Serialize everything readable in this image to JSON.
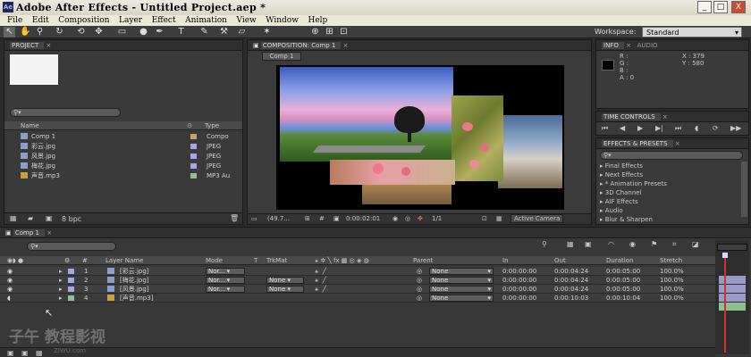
{
  "window": {
    "title": "Adobe After Effects - Untitled Project.aep *",
    "app_icon": "Ae",
    "controls": [
      "_",
      "□",
      "X"
    ]
  },
  "menu": [
    "File",
    "Edit",
    "Composition",
    "Layer",
    "Effect",
    "Animation",
    "View",
    "Window",
    "Help"
  ],
  "toolbar": {
    "workspace_label": "Workspace:",
    "workspace_value": "Standard"
  },
  "project": {
    "tab": "PROJECT",
    "search_placeholder": "",
    "columns": {
      "name": "Name",
      "type": "Type"
    },
    "items": [
      {
        "name": "Comp 1",
        "color": "#c9a26a",
        "type": "Compo",
        "icon": "composition-icon"
      },
      {
        "name": "彩云.jpg",
        "color": "#a6a6e6",
        "type": "JPEG",
        "icon": "image-icon"
      },
      {
        "name": "风景.jpg",
        "color": "#a6a6e6",
        "type": "JPEG",
        "icon": "image-icon"
      },
      {
        "name": "梅花.jpg",
        "color": "#a6a6e6",
        "type": "JPEG",
        "icon": "image-icon"
      },
      {
        "name": "声音.mp3",
        "color": "#8fc08f",
        "type": "MP3 Au",
        "icon": "audio-icon"
      }
    ],
    "bpc": "8 bpc"
  },
  "composition": {
    "tab": "COMPOSITION: Comp 1",
    "subtab": "Comp 1",
    "zoom": "(49.7...",
    "timecode": "0:00:02:01",
    "resolution": "1/1",
    "camera": "Active Camera"
  },
  "info": {
    "tab": "INFO",
    "tab2": "AUDIO",
    "r": "R :",
    "g": "G :",
    "b": "B :",
    "a": "A : 0",
    "x": "X : 379",
    "y": "Y : 580"
  },
  "time_controls": {
    "tab": "TIME CONTROLS"
  },
  "effects": {
    "tab": "EFFECTS & PRESETS",
    "search_placeholder": "",
    "items": [
      "Final Effects",
      "Next Effects",
      "* Animation Presets",
      "3D Channel",
      "AIF Effects",
      "Audio",
      "Blur & Sharpen"
    ]
  },
  "timeline": {
    "tab": "Comp 1",
    "columns": {
      "num": "#",
      "layer_name": "Layer Name",
      "mode": "Mode",
      "t": "T",
      "trkmat": "TrkMat",
      "parent": "Parent",
      "in": "In",
      "out": "Out",
      "duration": "Duration",
      "stretch": "Stretch"
    },
    "layers": [
      {
        "num": "1",
        "name": "[彩云.jpg]",
        "color": "#a6a6e6",
        "mode": "Nor...",
        "trkmat": "",
        "parent": "None",
        "in": "0:00:00:00",
        "out": "0:00:04:24",
        "duration": "0:00:05:00",
        "stretch": "100.0%"
      },
      {
        "num": "2",
        "name": "[梅花.jpg]",
        "color": "#a6a6e6",
        "mode": "Nor...",
        "trkmat": "None",
        "parent": "None",
        "in": "0:00:00:00",
        "out": "0:00:04:24",
        "duration": "0:00:05:00",
        "stretch": "100.0%"
      },
      {
        "num": "3",
        "name": "[风景.jpg]",
        "color": "#a6a6e6",
        "mode": "Nor...",
        "trkmat": "None",
        "parent": "None",
        "in": "0:00:00:00",
        "out": "0:00:04:24",
        "duration": "0:00:05:00",
        "stretch": "100.0%"
      },
      {
        "num": "4",
        "name": "[声音.mp3]",
        "color": "#8fc08f",
        "mode": "",
        "trkmat": "",
        "parent": "None",
        "in": "0:00:00:00",
        "out": "0:00:10:03",
        "duration": "0:00:10:04",
        "stretch": "100.0%"
      }
    ]
  },
  "watermark": {
    "text": "子午 教程影视",
    "sub": "ZIWU.com"
  }
}
